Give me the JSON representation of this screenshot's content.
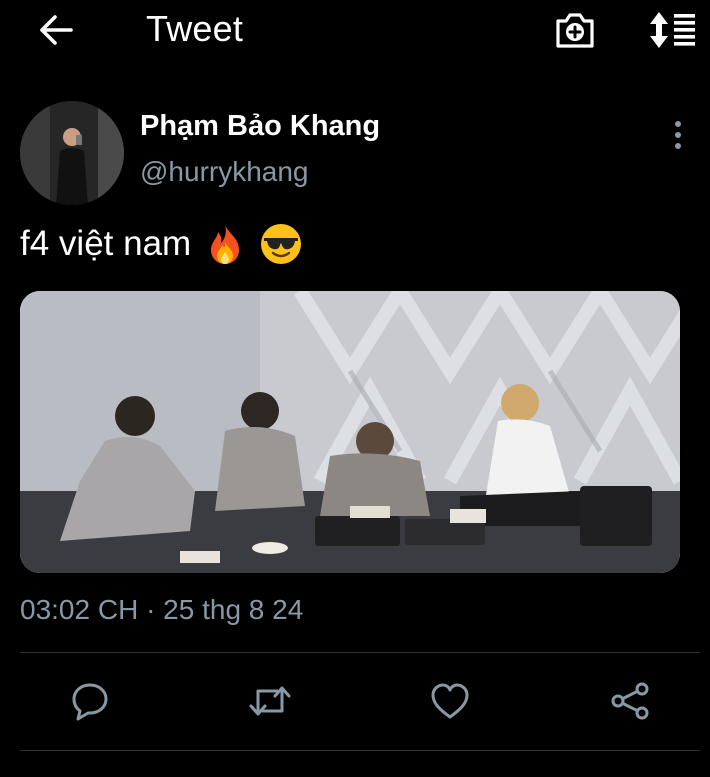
{
  "header": {
    "title": "Tweet",
    "back_icon": "arrow-left-icon",
    "camera_icon": "camera-add-icon",
    "sort_icon": "sort-list-icon"
  },
  "tweet": {
    "display_name": "Phạm Bảo Khang",
    "handle": "@hurrykhang",
    "text": "f4 việt nam",
    "emojis": [
      "fire-emoji",
      "sunglasses-emoji"
    ],
    "timestamp": "03:02 CH · 25 thg 8 24",
    "media_alt_icon": "photo"
  },
  "actions": {
    "reply_icon": "reply-icon",
    "retweet_icon": "retweet-icon",
    "like_icon": "heart-icon",
    "share_icon": "share-icon"
  },
  "colors": {
    "background": "#000000",
    "text_primary": "#ffffff",
    "text_secondary": "#8899a6",
    "divider": "#2f3336"
  }
}
